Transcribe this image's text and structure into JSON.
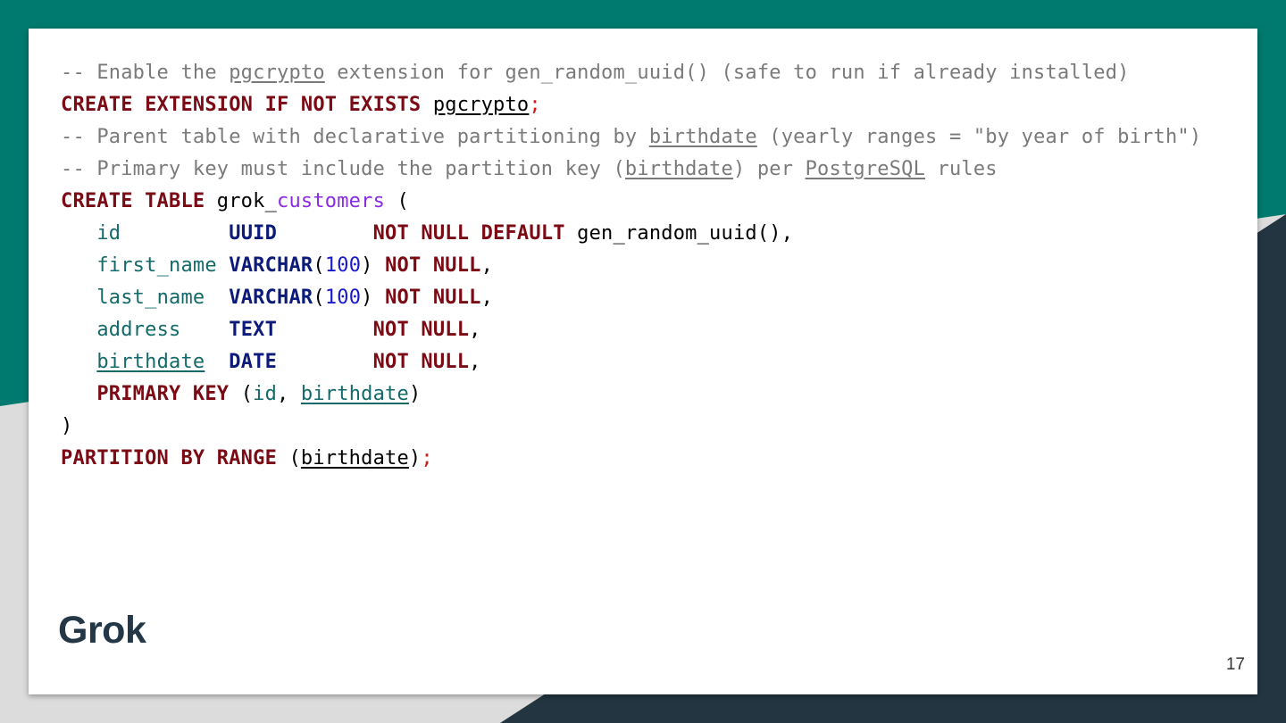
{
  "code_lines": [
    {
      "tokens": [
        {
          "text": "-- Enable the ",
          "style": "comment"
        },
        {
          "text": "pgcrypto",
          "style": "comment",
          "underline": true
        },
        {
          "text": " extension for gen_random_uuid() (safe to run if already installed)",
          "style": "comment"
        }
      ]
    },
    {
      "tokens": [
        {
          "text": "CREATE EXTENSION IF NOT EXISTS",
          "style": "kw"
        },
        {
          "text": " ",
          "style": "plain"
        },
        {
          "text": "pgcrypto",
          "style": "plain",
          "underline": true
        },
        {
          "text": ";",
          "style": "semi"
        }
      ]
    },
    {
      "tokens": [
        {
          "text": "-- Parent table with declarative partitioning by ",
          "style": "comment"
        },
        {
          "text": "birthdate",
          "style": "comment",
          "underline": true
        },
        {
          "text": " (yearly ranges = \"by year of birth\")",
          "style": "comment"
        }
      ]
    },
    {
      "tokens": [
        {
          "text": "-- Primary key must include the partition key (",
          "style": "comment"
        },
        {
          "text": "birthdate",
          "style": "comment",
          "underline": true
        },
        {
          "text": ") per ",
          "style": "comment"
        },
        {
          "text": "PostgreSQL",
          "style": "comment",
          "underline": true
        },
        {
          "text": " rules",
          "style": "comment"
        }
      ]
    },
    {
      "tokens": [
        {
          "text": "CREATE TABLE",
          "style": "kw"
        },
        {
          "text": " grok_",
          "style": "plain"
        },
        {
          "text": "customers",
          "style": "obj"
        },
        {
          "text": " (",
          "style": "plain"
        }
      ]
    },
    {
      "tokens": [
        {
          "text": "   ",
          "style": "plain"
        },
        {
          "text": "id",
          "style": "col"
        },
        {
          "text": "         ",
          "style": "plain"
        },
        {
          "text": "UUID",
          "style": "type"
        },
        {
          "text": "        ",
          "style": "plain"
        },
        {
          "text": "NOT NULL DEFAULT",
          "style": "kw"
        },
        {
          "text": " gen_random_uuid(),",
          "style": "plain"
        }
      ]
    },
    {
      "tokens": [
        {
          "text": "   ",
          "style": "plain"
        },
        {
          "text": "first_name",
          "style": "col"
        },
        {
          "text": " ",
          "style": "plain"
        },
        {
          "text": "VARCHAR",
          "style": "type"
        },
        {
          "text": "(",
          "style": "plain"
        },
        {
          "text": "100",
          "style": "num"
        },
        {
          "text": ") ",
          "style": "plain"
        },
        {
          "text": "NOT NULL",
          "style": "kw"
        },
        {
          "text": ",",
          "style": "plain"
        }
      ]
    },
    {
      "tokens": [
        {
          "text": "   ",
          "style": "plain"
        },
        {
          "text": "last_name",
          "style": "col"
        },
        {
          "text": "  ",
          "style": "plain"
        },
        {
          "text": "VARCHAR",
          "style": "type"
        },
        {
          "text": "(",
          "style": "plain"
        },
        {
          "text": "100",
          "style": "num"
        },
        {
          "text": ") ",
          "style": "plain"
        },
        {
          "text": "NOT NULL",
          "style": "kw"
        },
        {
          "text": ",",
          "style": "plain"
        }
      ]
    },
    {
      "tokens": [
        {
          "text": "   ",
          "style": "plain"
        },
        {
          "text": "address",
          "style": "col"
        },
        {
          "text": "    ",
          "style": "plain"
        },
        {
          "text": "TEXT",
          "style": "type"
        },
        {
          "text": "        ",
          "style": "plain"
        },
        {
          "text": "NOT NULL",
          "style": "kw"
        },
        {
          "text": ",",
          "style": "plain"
        }
      ]
    },
    {
      "tokens": [
        {
          "text": "   ",
          "style": "plain"
        },
        {
          "text": "birthdate",
          "style": "col",
          "underline": true
        },
        {
          "text": "  ",
          "style": "plain"
        },
        {
          "text": "DATE",
          "style": "type"
        },
        {
          "text": "        ",
          "style": "plain"
        },
        {
          "text": "NOT NULL",
          "style": "kw"
        },
        {
          "text": ",",
          "style": "plain"
        }
      ]
    },
    {
      "tokens": [
        {
          "text": "   ",
          "style": "plain"
        },
        {
          "text": "PRIMARY KEY",
          "style": "kw"
        },
        {
          "text": " (",
          "style": "plain"
        },
        {
          "text": "id",
          "style": "col"
        },
        {
          "text": ", ",
          "style": "plain"
        },
        {
          "text": "birthdate",
          "style": "col",
          "underline": true
        },
        {
          "text": ")",
          "style": "plain"
        }
      ]
    },
    {
      "tokens": [
        {
          "text": ")",
          "style": "plain"
        }
      ]
    },
    {
      "tokens": [
        {
          "text": "PARTITION BY RANGE",
          "style": "kw"
        },
        {
          "text": " (",
          "style": "plain"
        },
        {
          "text": "birthdate",
          "style": "plain",
          "underline": true
        },
        {
          "text": ")",
          "style": "plain"
        },
        {
          "text": ";",
          "style": "semi"
        }
      ]
    }
  ],
  "brand": {
    "label": "Grok"
  },
  "page": {
    "number": "17"
  },
  "colors": {
    "teal": "#007a6e",
    "dark_navy": "#223540",
    "light_gray": "#dcdcdc",
    "keyword": "#7b0a14",
    "type": "#0c1a7a",
    "column": "#146a6a",
    "number": "#1818cc",
    "comment": "#7a7a7a"
  }
}
